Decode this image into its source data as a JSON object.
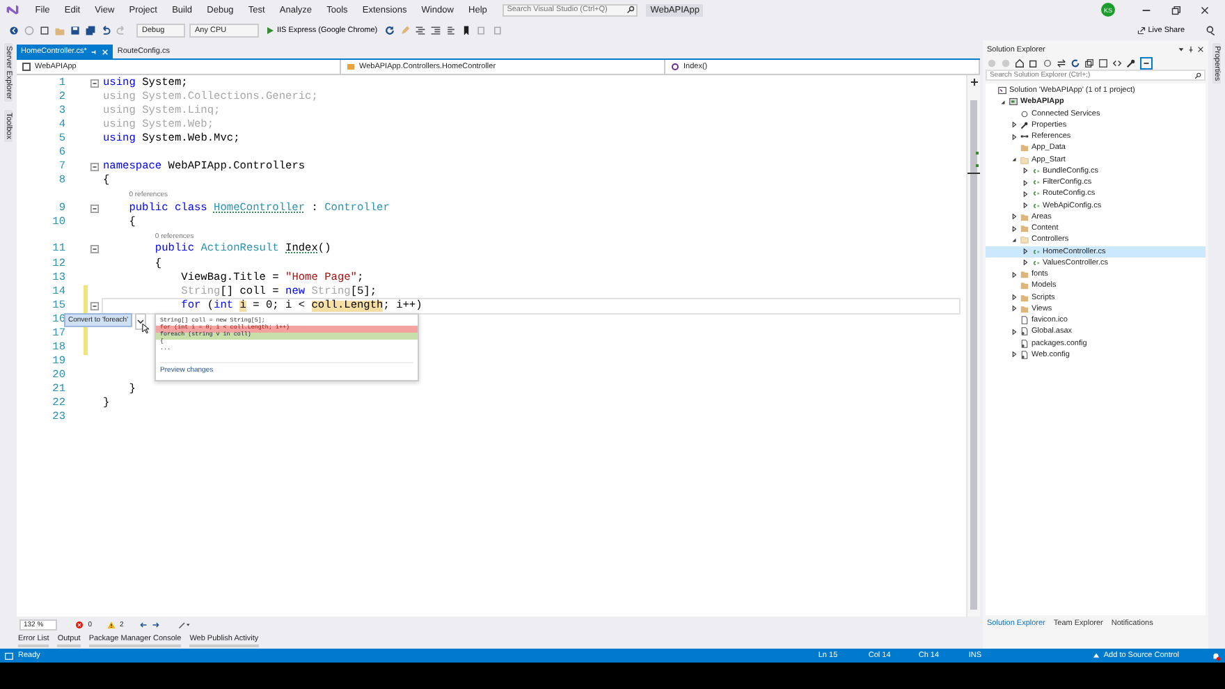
{
  "menu": [
    "File",
    "Edit",
    "View",
    "Project",
    "Build",
    "Debug",
    "Test",
    "Analyze",
    "Tools",
    "Extensions",
    "Window",
    "Help"
  ],
  "search": {
    "placeholder": "Search Visual Studio (Ctrl+Q)"
  },
  "solution_name": "WebAPIApp",
  "account": {
    "initials": "KS"
  },
  "toolbar": {
    "configuration": "Debug",
    "platform": "Any CPU",
    "run": "IIS Express (Google Chrome)",
    "live_share": "Live Share"
  },
  "left_strip": [
    "Server Explorer",
    "Toolbox"
  ],
  "right_strip": [
    "Properties"
  ],
  "doc_tabs": [
    {
      "label": "HomeController.cs*",
      "selected": true
    },
    {
      "label": "RouteConfig.cs",
      "selected": false
    }
  ],
  "nav_bar": [
    "WebAPIApp",
    "WebAPIApp.Controllers.HomeController",
    "Index()"
  ],
  "code": [
    {
      "number": "1",
      "fold": true,
      "changed": false,
      "current": false,
      "tokens": [
        {
          "kind": "kw",
          "text": "using"
        },
        {
          "kind": "plain",
          "text": " System;"
        }
      ]
    },
    {
      "number": "2",
      "fold": false,
      "changed": false,
      "current": false,
      "tokens": [
        {
          "kind": "faded",
          "text": "using System.Collections.Generic;"
        }
      ]
    },
    {
      "number": "3",
      "fold": false,
      "changed": false,
      "current": false,
      "tokens": [
        {
          "kind": "faded",
          "text": "using System.Linq;"
        }
      ]
    },
    {
      "number": "4",
      "fold": false,
      "changed": false,
      "current": false,
      "tokens": [
        {
          "kind": "faded",
          "text": "using System.Web;"
        }
      ]
    },
    {
      "number": "5",
      "fold": false,
      "changed": false,
      "current": false,
      "tokens": [
        {
          "kind": "kw",
          "text": "using"
        },
        {
          "kind": "plain",
          "text": " System.Web.Mvc;"
        }
      ]
    },
    {
      "number": "6",
      "fold": false,
      "changed": false,
      "current": false
    },
    {
      "number": "7",
      "fold": true,
      "changed": false,
      "current": false,
      "tokens": [
        {
          "kind": "kw",
          "text": "namespace"
        },
        {
          "kind": "plain",
          "text": " WebAPIApp.Controllers"
        }
      ]
    },
    {
      "number": "8",
      "fold": false,
      "changed": false,
      "current": false,
      "tokens": [
        {
          "kind": "plain",
          "text": "{"
        }
      ],
      "children": [
        {
          "number": "9",
          "fold": true,
          "changed": false,
          "current": false,
          "lens": "0 references",
          "tokens": [
            {
              "kind": "kw",
              "text": "public class "
            },
            {
              "kind": "type-squiggle",
              "text": "HomeController"
            },
            {
              "kind": "plain",
              "text": " : "
            },
            {
              "kind": "type",
              "text": "Controller"
            }
          ]
        },
        {
          "number": "10",
          "fold": false,
          "changed": false,
          "current": false,
          "tokens": [
            {
              "kind": "plain",
              "text": "{"
            }
          ],
          "children": [
            {
              "number": "11",
              "fold": true,
              "changed": false,
              "current": false,
              "lens": "0 references",
              "tokens": [
                {
                  "kind": "kw",
                  "text": "public "
                },
                {
                  "kind": "type",
                  "text": "ActionResult "
                },
                {
                  "kind": "plain-squiggle",
                  "text": "Index"
                },
                {
                  "kind": "plain",
                  "text": "()"
                }
              ]
            },
            {
              "number": "12",
              "fold": false,
              "changed": false,
              "current": false,
              "tokens": [
                {
                  "kind": "plain",
                  "text": "{"
                }
              ],
              "children": [
                {
                  "number": "13",
                  "fold": false,
                  "changed": false,
                  "current": false,
                  "tokens": [
                    {
                      "kind": "plain",
                      "text": "ViewBag.Title = "
                    },
                    {
                      "kind": "str",
                      "text": "\"Home Page\""
                    },
                    {
                      "kind": "plain",
                      "text": ";"
                    }
                  ]
                },
                {
                  "number": "14",
                  "fold": false,
                  "changed": true,
                  "current": false,
                  "tokens": [
                    {
                      "kind": "faded",
                      "text": "String"
                    },
                    {
                      "kind": "plain",
                      "text": "[] coll = "
                    },
                    {
                      "kind": "kw",
                      "text": "new "
                    },
                    {
                      "kind": "faded",
                      "text": "String"
                    },
                    {
                      "kind": "plain",
                      "text": "[5];"
                    }
                  ]
                },
                {
                  "number": "15",
                  "fold": true,
                  "changed": true,
                  "current": true,
                  "tokens": [
                    {
                      "kind": "kw",
                      "text": "for"
                    },
                    {
                      "kind": "plain",
                      "text": " ("
                    },
                    {
                      "kind": "kw",
                      "text": "int "
                    },
                    {
                      "kind": "highlight",
                      "text": "i"
                    },
                    {
                      "kind": "plain",
                      "text": " = 0; i < "
                    },
                    {
                      "kind": "highlight",
                      "text": "coll.Length"
                    },
                    {
                      "kind": "plain",
                      "text": "; i++)"
                    }
                  ]
                },
                {
                  "number": "16",
                  "fold": false,
                  "changed": true,
                  "current": false
                },
                {
                  "number": "17",
                  "fold": false,
                  "changed": true,
                  "current": false
                },
                {
                  "number": "18",
                  "fold": false,
                  "changed": true,
                  "current": false
                },
                {
                  "number": "19",
                  "fold": false,
                  "changed": false,
                  "current": false
                },
                {
                  "number": "20",
                  "fold": false,
                  "changed": false,
                  "current": false
                }
              ]
            }
          ]
        },
        {
          "number": "21",
          "fold": false,
          "changed": false,
          "current": false,
          "tokens": [
            {
              "kind": "plain",
              "text": "}"
            }
          ]
        }
      ]
    },
    {
      "number": "22",
      "fold": false,
      "changed": false,
      "current": false,
      "tokens": [
        {
          "kind": "plain",
          "text": "}"
        }
      ]
    },
    {
      "number": "23",
      "fold": false,
      "changed": false,
      "current": false
    }
  ],
  "quick_action": {
    "label": "Convert to 'foreach'",
    "preview": [
      {
        "kind": "plain",
        "text": "String[] coll = new String[5];"
      },
      {
        "kind": "removed",
        "text": "for (int i = 0; i < coll.Length; i++)"
      },
      {
        "kind": "added",
        "text": "foreach (string v in coll)"
      },
      {
        "kind": "plain",
        "text": "{"
      },
      {
        "kind": "plain",
        "text": "..."
      }
    ],
    "link": "Preview changes"
  },
  "editor_footer": {
    "zoom": "132 %",
    "errors": "0",
    "warnings": "2"
  },
  "tool_tabs": [
    "Error List",
    "Output",
    "Package Manager Console",
    "Web Publish Activity"
  ],
  "solution_explorer": {
    "title": "Solution Explorer",
    "search": {
      "placeholder": "Search Solution Explorer (Ctrl+;)"
    },
    "tree": [
      {
        "label": "Solution 'WebAPIApp' (1 of 1 project)",
        "kind": "solution",
        "selected": false,
        "children": [
          {
            "label": "WebAPIApp",
            "kind": "project",
            "expanded": true,
            "selected": false,
            "children": [
              {
                "label": "Connected Services",
                "kind": "service",
                "selected": false
              },
              {
                "label": "Properties",
                "kind": "wrench",
                "expanded": false,
                "selected": false
              },
              {
                "label": "References",
                "kind": "references",
                "expanded": false,
                "selected": false
              },
              {
                "label": "App_Data",
                "kind": "folder",
                "selected": false
              },
              {
                "label": "App_Start",
                "kind": "folder-open",
                "expanded": true,
                "selected": false,
                "children": [
                  {
                    "label": "BundleConfig.cs",
                    "kind": "csharp",
                    "expanded": false,
                    "selected": false
                  },
                  {
                    "label": "FilterConfig.cs",
                    "kind": "csharp",
                    "expanded": false,
                    "selected": false
                  },
                  {
                    "label": "RouteConfig.cs",
                    "kind": "csharp",
                    "expanded": false,
                    "selected": false
                  },
                  {
                    "label": "WebApiConfig.cs",
                    "kind": "csharp",
                    "expanded": false,
                    "selected": false
                  }
                ]
              },
              {
                "label": "Areas",
                "kind": "folder",
                "expanded": false,
                "selected": false
              },
              {
                "label": "Content",
                "kind": "folder",
                "expanded": false,
                "selected": false
              },
              {
                "label": "Controllers",
                "kind": "folder-open",
                "expanded": true,
                "selected": false,
                "children": [
                  {
                    "label": "HomeController.cs",
                    "kind": "csharp",
                    "expanded": false,
                    "selected": true
                  },
                  {
                    "label": "ValuesController.cs",
                    "kind": "csharp",
                    "expanded": false,
                    "selected": false
                  }
                ]
              },
              {
                "label": "fonts",
                "kind": "folder",
                "expanded": false,
                "selected": false
              },
              {
                "label": "Models",
                "kind": "folder",
                "selected": false
              },
              {
                "label": "Scripts",
                "kind": "folder",
                "expanded": false,
                "selected": false
              },
              {
                "label": "Views",
                "kind": "folder",
                "expanded": false,
                "selected": false
              },
              {
                "label": "favicon.ico",
                "kind": "file",
                "selected": false
              },
              {
                "label": "Global.asax",
                "kind": "config",
                "expanded": false,
                "selected": false
              },
              {
                "label": "packages.config",
                "kind": "config",
                "selected": false
              },
              {
                "label": "Web.config",
                "kind": "config",
                "expanded": false,
                "selected": false
              }
            ]
          }
        ]
      }
    ],
    "bottom_tabs": [
      {
        "label": "Solution Explorer",
        "selected": true
      },
      {
        "label": "Team Explorer",
        "selected": false
      },
      {
        "label": "Notifications",
        "selected": false
      }
    ]
  },
  "status_bar": {
    "message": "Ready",
    "line": "Ln 15",
    "column": "Col 14",
    "char": "Ch 14",
    "mode": "INS",
    "source_control": "Add to Source Control"
  }
}
